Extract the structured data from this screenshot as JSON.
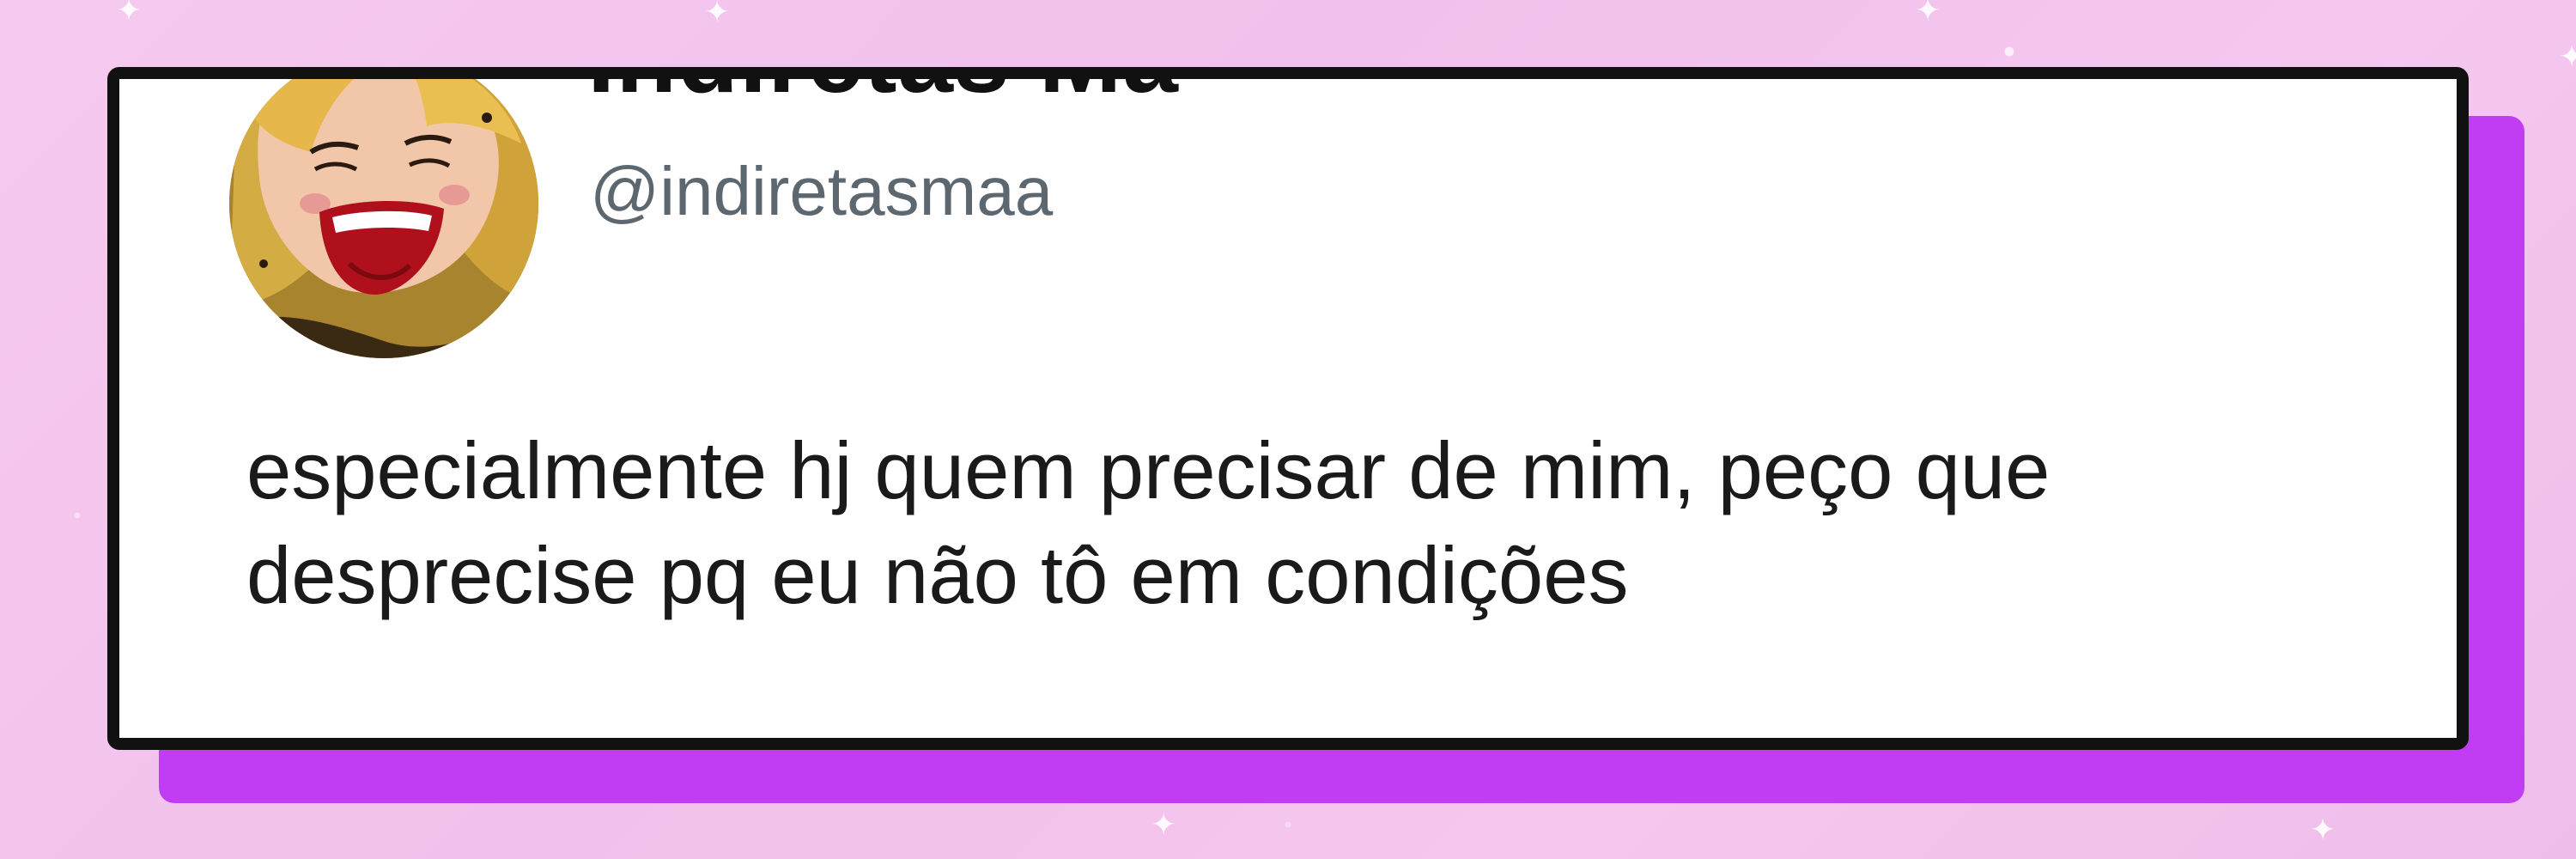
{
  "tweet": {
    "display_name": "Indiretas Ma",
    "handle": "@indiretasmaa",
    "text": "especialmente hj quem precisar de mim, peço que desprecise pq eu não tô em condições"
  },
  "colors": {
    "background": "#f3c6ee",
    "accent_shadow": "#c13df3",
    "card": "#ffffff",
    "border": "#111111",
    "handle": "#5d6770"
  },
  "avatar": {
    "icon": "cartoon-face-avatar"
  }
}
